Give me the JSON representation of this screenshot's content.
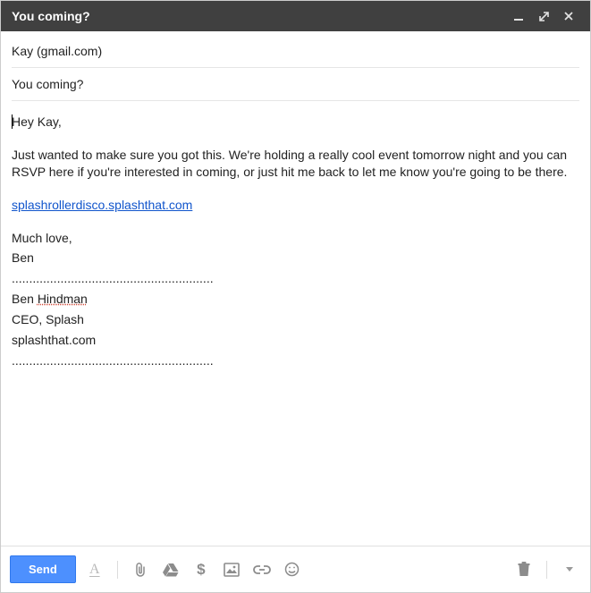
{
  "header": {
    "title": "You coming?"
  },
  "fields": {
    "to": "Kay (gmail.com)",
    "subject": "You coming?"
  },
  "body": {
    "greeting": "Hey Kay,",
    "para1": "Just wanted to make sure you got this. We're holding a really cool event tomorrow night and you can RSVP here if you're interested in coming, or just hit me back to let me know you're going to be there.",
    "link_text": "splashrollerdisco.splashthat.com",
    "closing_line1": "Much love,",
    "closing_line2": "Ben",
    "sig_divider": "..........................................................",
    "sig_name_first": "Ben ",
    "sig_name_last": "Hindman",
    "sig_title": "CEO, Splash",
    "sig_site": "splashthat.com",
    "sig_divider2": ".........................................................."
  },
  "toolbar": {
    "send_label": "Send"
  },
  "icons": {
    "minimize": "minimize",
    "popout": "popout",
    "close": "close",
    "format": "A",
    "attach": "attach",
    "drive": "drive",
    "money": "$",
    "photo": "photo",
    "link": "link",
    "emoji": "emoji",
    "trash": "trash",
    "more": "more"
  }
}
